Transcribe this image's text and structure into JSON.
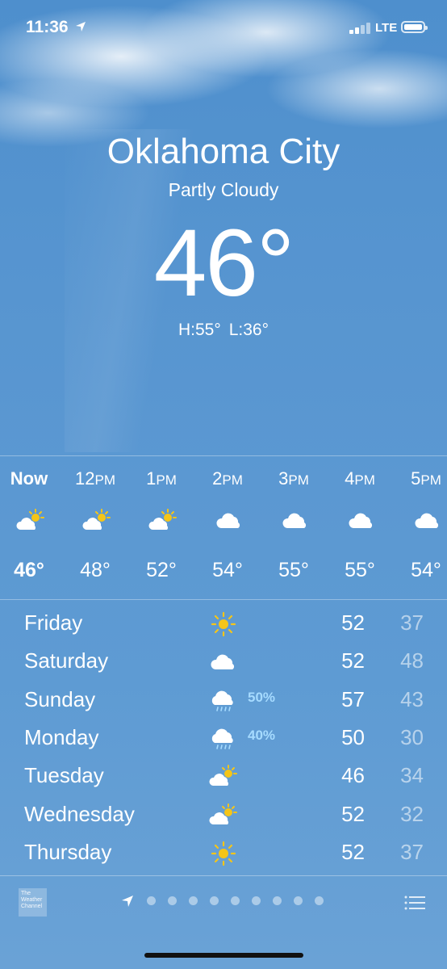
{
  "status_bar": {
    "time": "11:36",
    "network": "LTE"
  },
  "header": {
    "city": "Oklahoma City",
    "condition": "Partly Cloudy",
    "temperature": "46°",
    "high": "H:55°",
    "low": "L:36°"
  },
  "hourly": [
    {
      "label": "Now",
      "suffix": "",
      "icon": "partly-sunny-icon",
      "temp": "46°",
      "bold": true
    },
    {
      "label": "12",
      "suffix": "PM",
      "icon": "partly-sunny-icon",
      "temp": "48°"
    },
    {
      "label": "1",
      "suffix": "PM",
      "icon": "partly-sunny-icon",
      "temp": "52°"
    },
    {
      "label": "2",
      "suffix": "PM",
      "icon": "cloud-icon",
      "temp": "54°"
    },
    {
      "label": "3",
      "suffix": "PM",
      "icon": "cloud-icon",
      "temp": "55°"
    },
    {
      "label": "4",
      "suffix": "PM",
      "icon": "cloud-icon",
      "temp": "55°"
    },
    {
      "label": "5",
      "suffix": "PM",
      "icon": "cloud-icon",
      "temp": "54°"
    }
  ],
  "daily": [
    {
      "day": "Friday",
      "icon": "sun-icon",
      "precip": "",
      "high": "52",
      "low": "37"
    },
    {
      "day": "Saturday",
      "icon": "cloud-icon",
      "precip": "",
      "high": "52",
      "low": "48"
    },
    {
      "day": "Sunday",
      "icon": "rain-cloud-icon",
      "precip": "50%",
      "high": "57",
      "low": "43"
    },
    {
      "day": "Monday",
      "icon": "rain-cloud-icon",
      "precip": "40%",
      "high": "50",
      "low": "30"
    },
    {
      "day": "Tuesday",
      "icon": "partly-sunny-icon",
      "precip": "",
      "high": "46",
      "low": "34"
    },
    {
      "day": "Wednesday",
      "icon": "partly-sunny-icon",
      "precip": "",
      "high": "52",
      "low": "32"
    },
    {
      "day": "Thursday",
      "icon": "sun-icon",
      "precip": "",
      "high": "52",
      "low": "37"
    }
  ],
  "footer": {
    "logo_text": "The Weather Channel",
    "page_count": 9
  },
  "colors": {
    "precip": "#a6dbff",
    "sun": "#f5c518",
    "background": "#5b98d2"
  }
}
